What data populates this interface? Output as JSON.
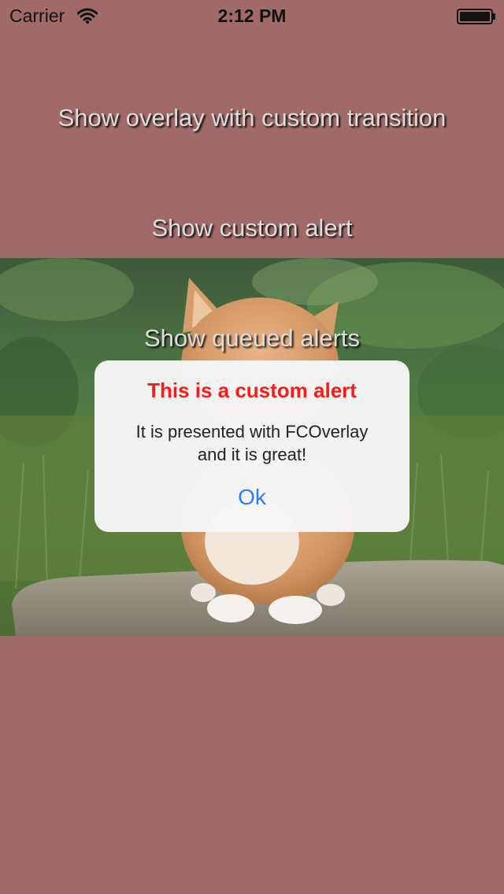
{
  "status_bar": {
    "carrier": "Carrier",
    "time": "2:12 PM",
    "wifi_icon": "wifi-icon",
    "battery_icon": "battery-full-icon"
  },
  "menu": {
    "buttons": [
      {
        "label": "Show overlay with custom transition"
      },
      {
        "label": "Show custom alert"
      },
      {
        "label": "Show queued alerts"
      }
    ]
  },
  "background_image": {
    "subject": "kitten-photo"
  },
  "alert": {
    "title": "This is a custom alert",
    "message_line_1": "It is presented with FCOverlay",
    "message_line_2": "and it is great!",
    "ok_label": "Ok"
  },
  "colors": {
    "background": "#a06a6a",
    "alert_title": "#ff1a1a",
    "ok_button": "#2a7fe8"
  }
}
